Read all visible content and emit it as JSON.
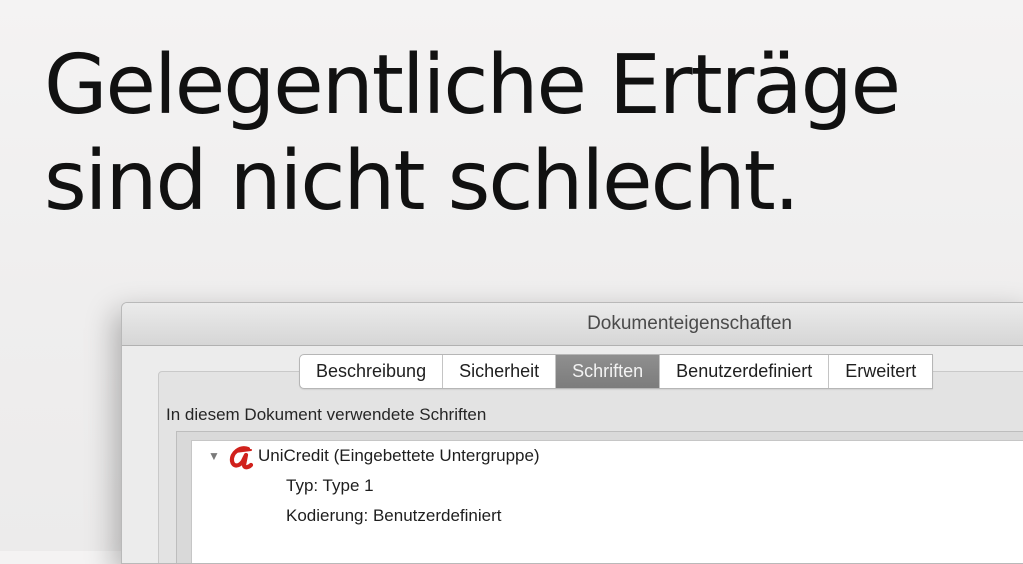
{
  "headline": {
    "line1": "Gelegentliche Erträge",
    "line2": "sind nicht schlecht."
  },
  "dialog": {
    "title": "Dokumenteigenschaften",
    "tabs": [
      {
        "label": "Beschreibung",
        "active": false
      },
      {
        "label": "Sicherheit",
        "active": false
      },
      {
        "label": "Schriften",
        "active": true
      },
      {
        "label": "Benutzerdefiniert",
        "active": false
      },
      {
        "label": "Erweitert",
        "active": false
      }
    ],
    "section_label": "In diesem Dokument verwendete Schriften",
    "fonts": [
      {
        "icon": "type1-font-icon",
        "name": "UniCredit (Eingebettete Untergruppe)",
        "type": "Typ: Type 1",
        "encoding": "Kodierung: Benutzerdefiniert"
      }
    ]
  },
  "colors": {
    "background": "#efeeee",
    "headline": "#111111",
    "active_tab": "#858585",
    "font_icon": "#d0211c"
  }
}
